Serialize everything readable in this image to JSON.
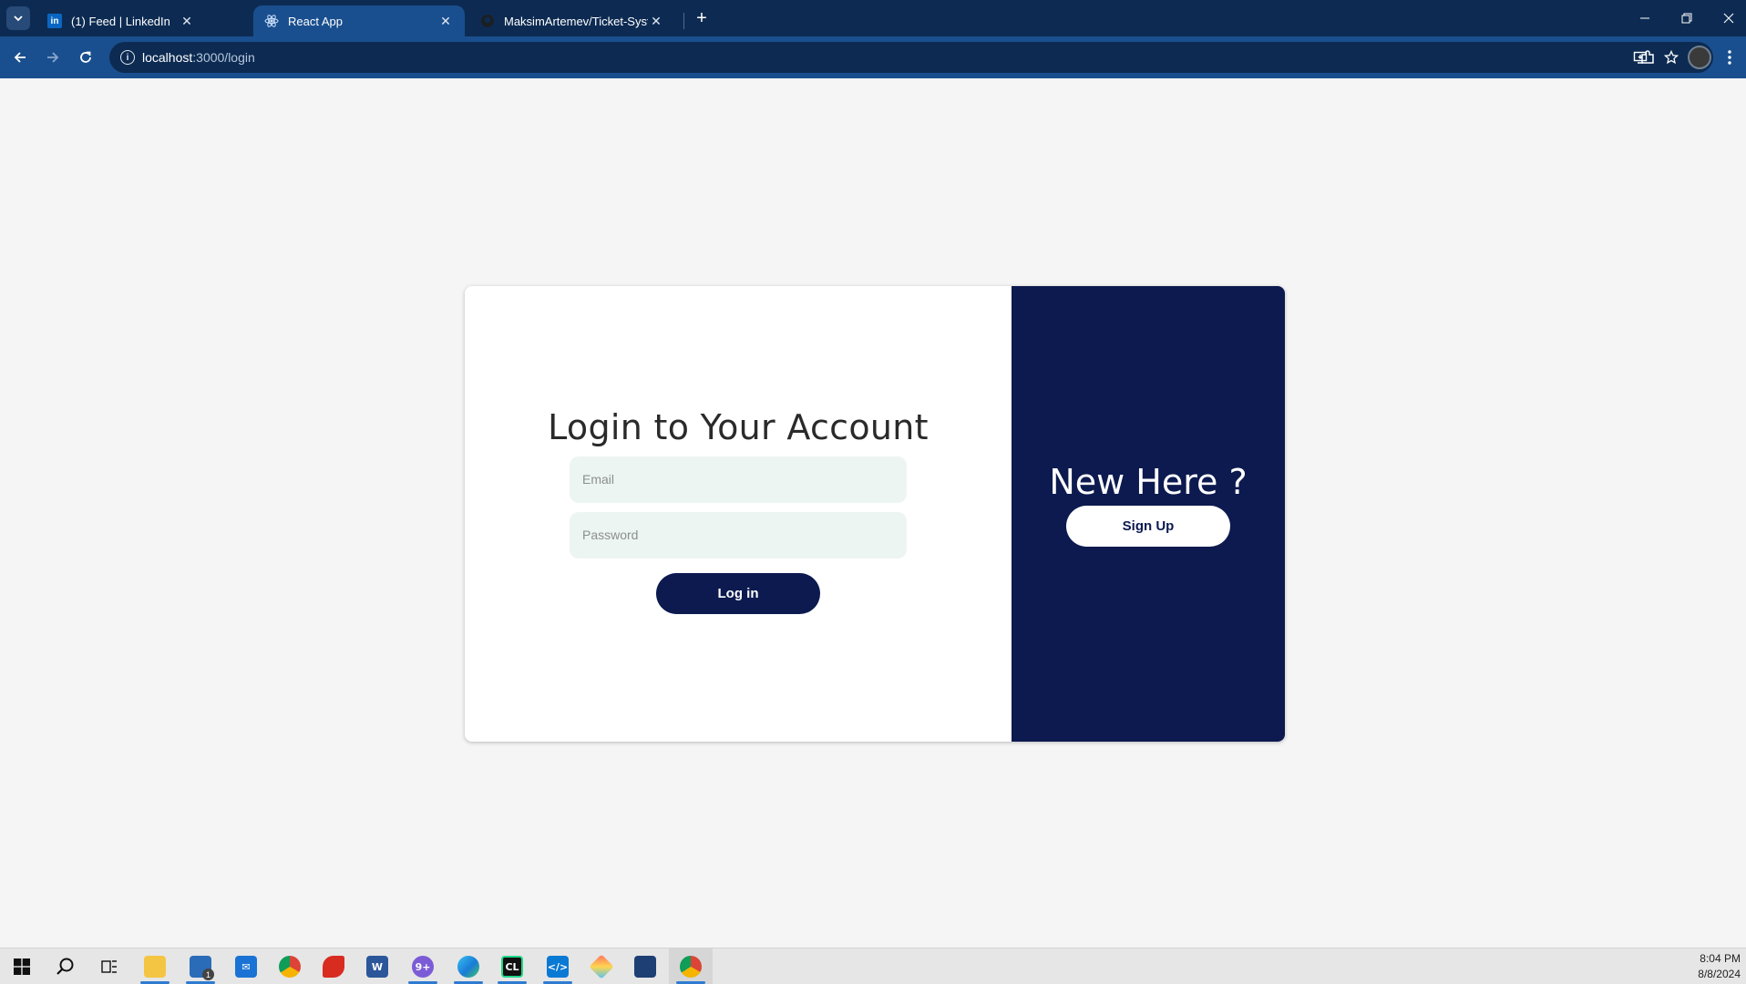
{
  "browser": {
    "tabs": [
      {
        "title": "(1) Feed | LinkedIn",
        "favicon": "linkedin-icon"
      },
      {
        "title": "React App",
        "favicon": "react-icon"
      },
      {
        "title": "MaksimArtemev/Ticket-System",
        "favicon": "github-icon"
      }
    ],
    "active_tab_index": 1,
    "url_host": "localhost",
    "url_path": ":3000/login"
  },
  "login": {
    "title": "Login to Your Account",
    "email_placeholder": "Email",
    "password_placeholder": "Password",
    "login_button": "Log in"
  },
  "signup": {
    "title": "New Here ?",
    "signup_button": "Sign Up"
  },
  "taskbar": {
    "time": "8:04 PM",
    "date": "8/8/2024",
    "store_badge": "1"
  },
  "colors": {
    "brand_navy": "#0c1a4f",
    "field_bg": "#edf5f3",
    "browser_frame": "#0d2b52",
    "browser_toolbar": "#1a4f8f"
  }
}
